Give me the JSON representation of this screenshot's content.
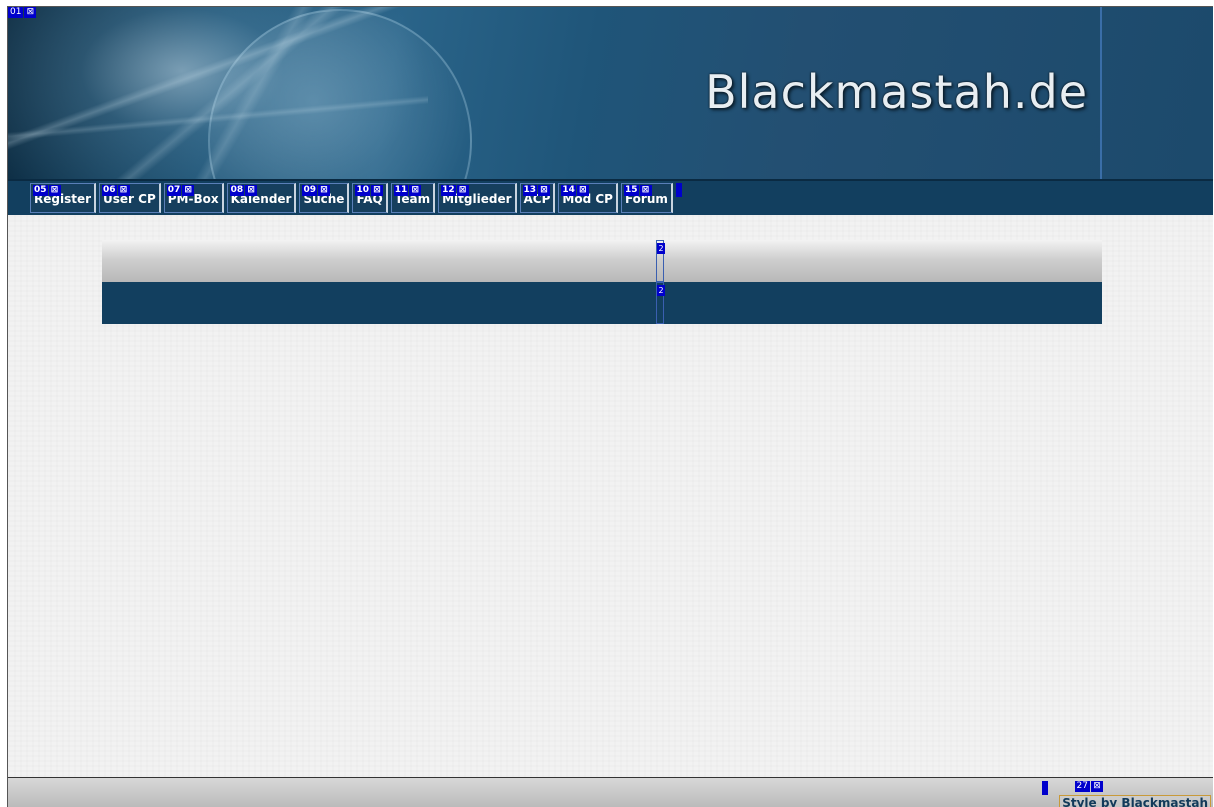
{
  "header": {
    "title": "Blackmastah.de",
    "badge": {
      "num": "01",
      "icon": "image-placeholder-icon"
    }
  },
  "nav": {
    "items": [
      {
        "num": "05",
        "label": "Register"
      },
      {
        "num": "06",
        "label": "User CP"
      },
      {
        "num": "07",
        "label": "PM-Box"
      },
      {
        "num": "08",
        "label": "Kalender"
      },
      {
        "num": "09",
        "label": "Suche"
      },
      {
        "num": "10",
        "label": "FAQ"
      },
      {
        "num": "11",
        "label": "Team"
      },
      {
        "num": "12",
        "label": "Mitglieder"
      },
      {
        "num": "13",
        "label": "ACP"
      },
      {
        "num": "14",
        "label": "Mod CP"
      },
      {
        "num": "15",
        "label": "Forum"
      }
    ],
    "badge_icon": "⊠"
  },
  "content": {
    "cell_marker_label": "2"
  },
  "footer": {
    "credit": "Style by Blackmastah",
    "badge": {
      "num": "27",
      "icon": "⊠"
    }
  },
  "colors": {
    "header_bg": "#1d5274",
    "nav_bg": "#123f5f",
    "marker_blue": "#0000cc",
    "page_bg": "#f2f2f2"
  }
}
